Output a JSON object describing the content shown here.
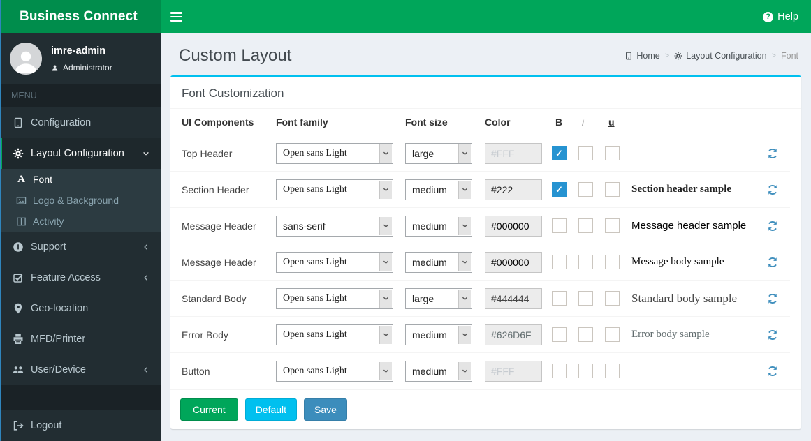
{
  "topbar": {
    "brand": "Business Connect",
    "help": "Help"
  },
  "sidebar": {
    "user": {
      "name": "imre-admin",
      "role": "Administrator"
    },
    "menu_header": "MENU",
    "items": [
      {
        "label": "Configuration"
      },
      {
        "label": "Layout Configuration",
        "active": true,
        "expanded": true
      },
      {
        "label": "Font",
        "active": true
      },
      {
        "label": "Logo & Background"
      },
      {
        "label": "Activity"
      },
      {
        "label": "Support",
        "collapsed": true
      },
      {
        "label": "Feature Access",
        "collapsed": true
      },
      {
        "label": "Geo-location"
      },
      {
        "label": "MFD/Printer"
      },
      {
        "label": "User/Device",
        "collapsed": true
      },
      {
        "label": "Logout"
      }
    ]
  },
  "content": {
    "page_title": "Custom Layout",
    "breadcrumb": [
      {
        "label": "Home"
      },
      {
        "label": "Layout Configuration"
      },
      {
        "label": "Font"
      }
    ],
    "panel": {
      "title": "Font Customization",
      "table": {
        "headers": {
          "component": "UI Components",
          "family": "Font family",
          "size": "Font size",
          "color": "Color",
          "bold": "B",
          "italic": "i",
          "underline": "u"
        },
        "rows": [
          {
            "component": "Top Header",
            "font_family": "Open sans Light",
            "font_size": "large",
            "color": "#FFF",
            "bold": true,
            "italic": false,
            "underline": false,
            "sample": ""
          },
          {
            "component": "Section Header",
            "font_family": "Open sans Light",
            "font_size": "medium",
            "color": "#222",
            "bold": true,
            "italic": false,
            "underline": false,
            "sample": "Section header sample"
          },
          {
            "component": "Message Header",
            "font_family": "sans-serif",
            "font_size": "medium",
            "color": "#000000",
            "bold": false,
            "italic": false,
            "underline": false,
            "sample": "Message header sample"
          },
          {
            "component": "Message Header",
            "font_family": "Open sans Light",
            "font_size": "medium",
            "color": "#000000",
            "bold": false,
            "italic": false,
            "underline": false,
            "sample": "Message body sample"
          },
          {
            "component": "Standard Body",
            "font_family": "Open sans Light",
            "font_size": "large",
            "color": "#444444",
            "bold": false,
            "italic": false,
            "underline": false,
            "sample": "Standard body sample"
          },
          {
            "component": "Error Body",
            "font_family": "Open sans Light",
            "font_size": "medium",
            "color": "#626D6F",
            "bold": false,
            "italic": false,
            "underline": false,
            "sample": "Error body sample"
          },
          {
            "component": "Button",
            "font_family": "Open sans Light",
            "font_size": "medium",
            "color": "#FFF",
            "bold": false,
            "italic": false,
            "underline": false,
            "sample": ""
          }
        ]
      },
      "buttons": [
        {
          "label": "Current",
          "color": "#00a65a"
        },
        {
          "label": "Default",
          "color": "#00c0ef"
        },
        {
          "label": "Save",
          "color": "#3c8dbc"
        }
      ]
    }
  },
  "theme": {
    "navbar_green": "#00a65a",
    "logo_green": "#008d4c",
    "sidebar_dark": "#222d32",
    "panel_accent_cyan": "#00c0ef",
    "checkbox_checked_blue": "#2693d1",
    "refresh_blue": "#3c8dbc",
    "content_background": "#ecf0f5"
  }
}
